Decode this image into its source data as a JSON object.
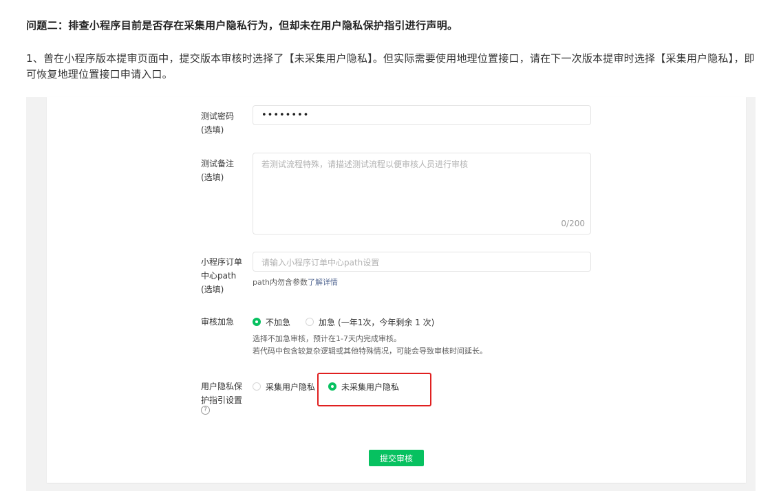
{
  "doc": {
    "heading": "问题二：排查小程序目前是否存在采集用户隐私行为，但却未在用户隐私保护指引进行声明。",
    "paragraph": "1、曾在小程序版本提审页面中，提交版本审核时选择了【未采集用户隐私】。但实际需要使用地理位置接口，请在下一次版本提审时选择【采集用户隐私】，即可恢复地理位置接口申请入口。"
  },
  "form": {
    "password": {
      "label": "测试密码\n(选填)",
      "value": "••••••••"
    },
    "notes": {
      "label": "测试备注\n(选填)",
      "placeholder": "若测试流程特殊，请描述测试流程以便审核人员进行审核",
      "counter": "0/200"
    },
    "order_path": {
      "label": "小程序订单\n中心path\n(选填)",
      "placeholder": "请输入小程序订单中心path设置",
      "hint_prefix": "path内勿含参数",
      "hint_link": "了解详情"
    },
    "urgent": {
      "label": "审核加急",
      "option_normal": "不加急",
      "option_urgent": "加急",
      "option_urgent_note": "(一年1次，今年剩余 1 次)",
      "desc_line1": "选择不加急审核，预计在1-7天内完成审核。",
      "desc_line2": "若代码中包含较复杂逻辑或其他特殊情况，可能会导致审核时间延长。",
      "selected": "不加急"
    },
    "privacy": {
      "label": "用户隐私保\n护指引设置",
      "help_icon": "?",
      "option_collect": "采集用户隐私",
      "option_not_collect": "未采集用户隐私",
      "selected": "未采集用户隐私"
    },
    "submit_label": "提交审核"
  },
  "colors": {
    "accent": "#07c160",
    "link": "#576b95",
    "highlight": "#e02020"
  }
}
